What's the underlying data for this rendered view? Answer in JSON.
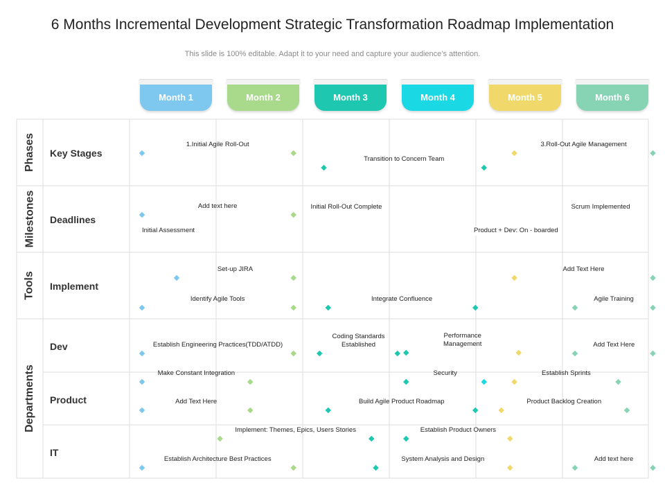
{
  "title": "6 Months Incremental Development Strategic Transformation Roadmap Implementation",
  "subtitle": "This slide is 100% editable. Adapt it to your need and capture your audience’s attention.",
  "colors": {
    "blue": "#7ec8f0",
    "green": "#a9d98a",
    "teal": "#1ec8b0",
    "cyan": "#1ad8e4",
    "yellow": "#f0d96a",
    "mint": "#87d4b4"
  },
  "months": [
    {
      "label": "Month 1",
      "color": "#7ec8f0"
    },
    {
      "label": "Month 2",
      "color": "#a9d98a"
    },
    {
      "label": "Month 3",
      "color": "#1ec8b0"
    },
    {
      "label": "Month 4",
      "color": "#1ad8e4"
    },
    {
      "label": "Month 5",
      "color": "#f0d96a"
    },
    {
      "label": "Month 6",
      "color": "#87d4b4"
    }
  ],
  "sections": [
    "Phases",
    "Milestones",
    "Tools",
    "Departments"
  ],
  "rows": [
    "Key Stages",
    "Deadlines",
    "Implement",
    "Dev",
    "Product",
    "IT"
  ],
  "tasks": [
    {
      "label": "1.Initial  Agile Roll-Out",
      "start": 0,
      "end": 1.75,
      "c1": "#7ec8f0",
      "c2": "#a9d98a"
    },
    {
      "label": "3.Roll-Out  Agile Management",
      "start": 4.3,
      "end": 5.9,
      "c1": "#f0d96a",
      "c2": "#87d4b4"
    },
    {
      "label": "Transition to Concern Team",
      "start": 2.1,
      "end": 3.95,
      "c1": "#1ec8b0",
      "c2": "#1ec8b0"
    },
    {
      "label": "Add text here",
      "start": 0,
      "end": 1.75,
      "c1": "#7ec8f0",
      "c2": "#a9d98a"
    },
    {
      "label": "Initial Roll-Out Complete",
      "start": 0,
      "end": 0,
      "c1": "",
      "c2": ""
    },
    {
      "label": "Scrum Implemented",
      "start": 0,
      "end": 0,
      "c1": "",
      "c2": ""
    },
    {
      "label": "Initial Assessment",
      "start": 0,
      "end": 0,
      "c1": "",
      "c2": ""
    },
    {
      "label": "Product + Dev: On - boarded",
      "start": 0,
      "end": 0,
      "c1": "",
      "c2": ""
    },
    {
      "label": "Set-up JIRA",
      "start": 0.4,
      "end": 1.75,
      "c1": "#7ec8f0",
      "c2": "#a9d98a"
    },
    {
      "label": "Add Text Here",
      "start": 4.3,
      "end": 5.9,
      "c1": "#f0d96a",
      "c2": "#87d4b4"
    },
    {
      "label": "Identify Agile Tools",
      "start": 0,
      "end": 1.75,
      "c1": "#7ec8f0",
      "c2": "#a9d98a"
    },
    {
      "label": "Integrate Confluence",
      "start": 2.15,
      "end": 3.85,
      "c1": "#1ec8b0",
      "c2": "#1ec8b0"
    },
    {
      "label": "Agile Training",
      "start": 5.0,
      "end": 5.9,
      "c1": "#87d4b4",
      "c2": "#87d4b4"
    },
    {
      "label": "Establish Engineering Practices(TDD/ATDD)",
      "start": 0,
      "end": 1.75,
      "c1": "#7ec8f0",
      "c2": "#a9d98a"
    },
    {
      "label": "Coding Standards\nEstablished",
      "start": 2.05,
      "end": 2.95,
      "c1": "#1ec8b0",
      "c2": "#1ec8b0"
    },
    {
      "label": "Performance\nManagement",
      "start": 3.05,
      "end": 4.35,
      "c1": "#1ec8b0",
      "c2": "#f0d96a"
    },
    {
      "label": "Add Text Here",
      "start": 5.0,
      "end": 5.9,
      "c1": "#87d4b4",
      "c2": "#87d4b4"
    },
    {
      "label": "Make Constant Integration",
      "start": 0,
      "end": 1.25,
      "c1": "#7ec8f0",
      "c2": "#a9d98a"
    },
    {
      "label": "Security",
      "start": 3.05,
      "end": 3.95,
      "c1": "#1ec8b0",
      "c2": "#1ad8e4"
    },
    {
      "label": "Establish Sprints",
      "start": 4.3,
      "end": 5.5,
      "c1": "#f0d96a",
      "c2": "#87d4b4"
    },
    {
      "label": "Add Text Here",
      "start": 0,
      "end": 1.25,
      "c1": "#7ec8f0",
      "c2": "#a9d98a"
    },
    {
      "label": "Build Agile Product Roadmap",
      "start": 2.15,
      "end": 3.85,
      "c1": "#1ec8b0",
      "c2": "#1ec8b0"
    },
    {
      "label": "Product Backlog Creation",
      "start": 4.15,
      "end": 5.6,
      "c1": "#f0d96a",
      "c2": "#87d4b4"
    },
    {
      "label": "Implement: Themes, Epics, Users Stories",
      "start": 0.9,
      "end": 2.65,
      "c1": "#a9d98a",
      "c2": "#1ec8b0"
    },
    {
      "label": "Establish Product Owners",
      "start": 3.05,
      "end": 4.25,
      "c1": "#1ec8b0",
      "c2": "#f0d96a"
    },
    {
      "label": "Establish Architecture Best Practices",
      "start": 0,
      "end": 1.75,
      "c1": "#7ec8f0",
      "c2": "#a9d98a"
    },
    {
      "label": "System Analysis and Design",
      "start": 2.7,
      "end": 4.25,
      "c1": "#1ec8b0",
      "c2": "#f0d96a"
    },
    {
      "label": "Add text here",
      "start": 5.0,
      "end": 5.9,
      "c1": "#87d4b4",
      "c2": "#87d4b4"
    }
  ]
}
